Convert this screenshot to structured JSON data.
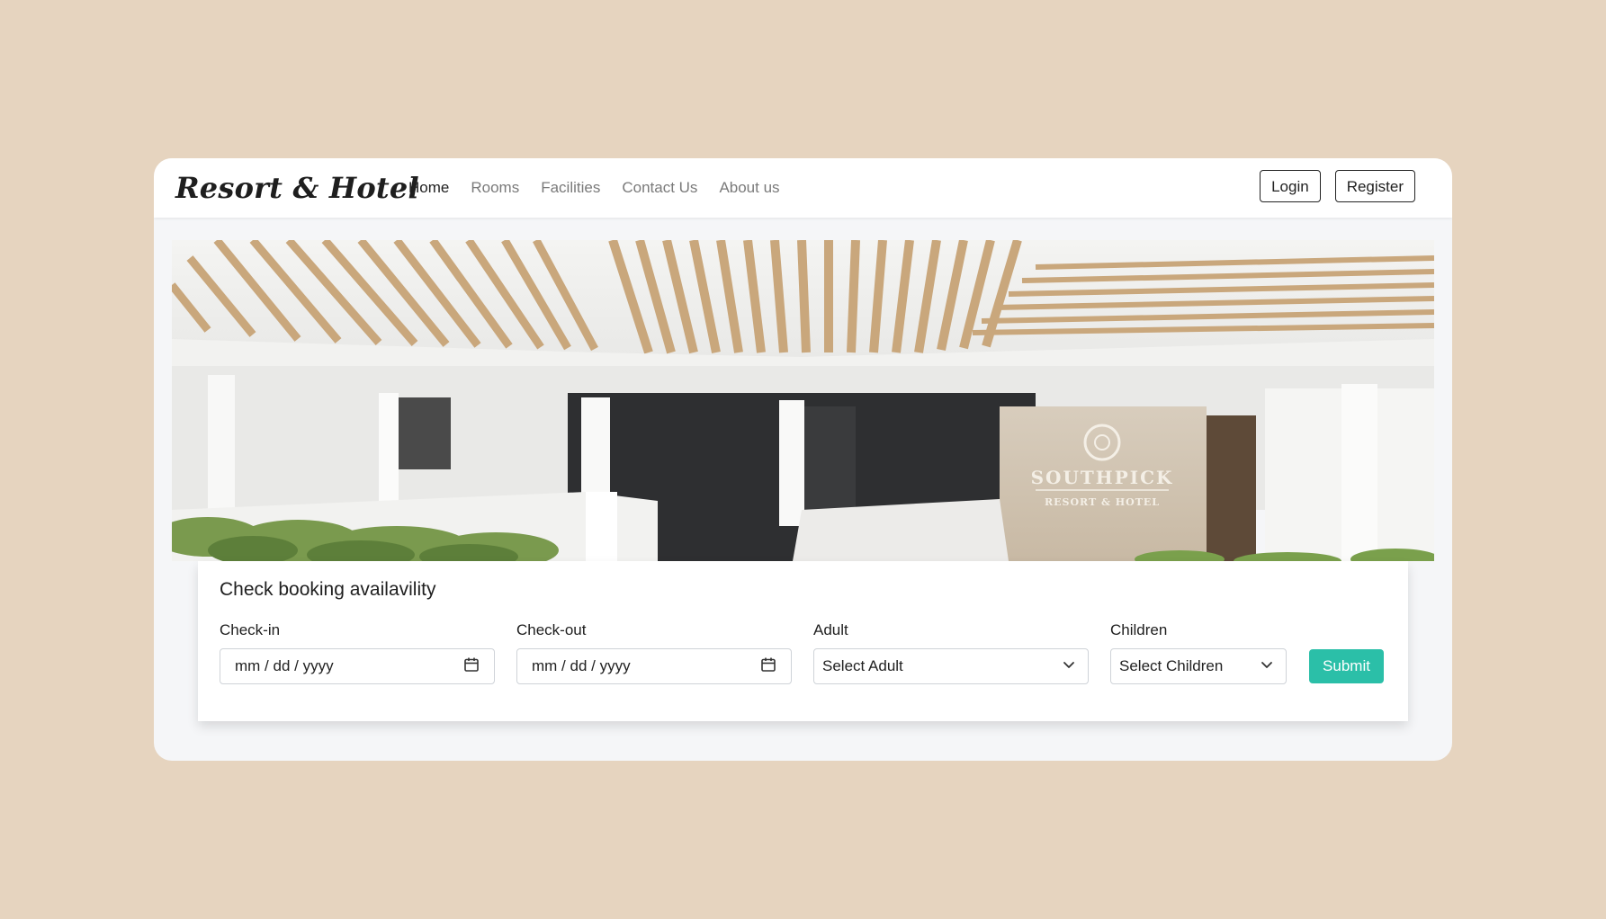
{
  "brand": {
    "name": "Resort & Hotel"
  },
  "nav": {
    "links": [
      {
        "label": "Home",
        "active": true
      },
      {
        "label": "Rooms",
        "active": false
      },
      {
        "label": "Facilities",
        "active": false
      },
      {
        "label": "Contact Us",
        "active": false
      },
      {
        "label": "About us",
        "active": false
      }
    ],
    "login_label": "Login",
    "register_label": "Register"
  },
  "hero": {
    "sign_line1": "SOUTHPICK",
    "sign_line2": "RESORT & HOTEL"
  },
  "booking": {
    "title": "Check booking availavility",
    "checkin_label": "Check-in",
    "checkin_value": "mm / dd / yyyy",
    "checkout_label": "Check-out",
    "checkout_value": "mm / dd / yyyy",
    "adult_label": "Adult",
    "adult_value": "Select Adult",
    "children_label": "Children",
    "children_value": "Select Children",
    "submit_label": "Submit"
  },
  "colors": {
    "page_background": "#e6d4bf",
    "accent": "#2bbfa8"
  },
  "icons": {
    "date": "calendar-icon",
    "select": "chevron-down-icon"
  }
}
